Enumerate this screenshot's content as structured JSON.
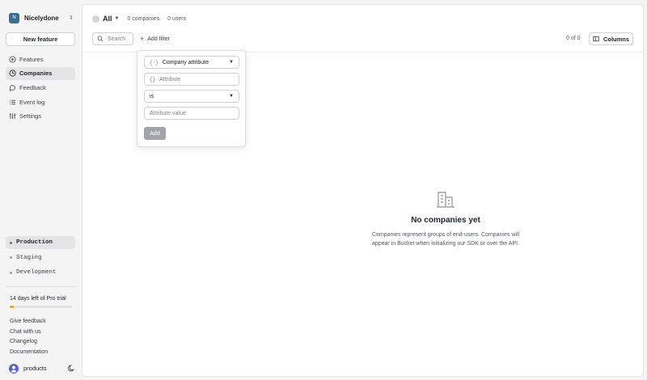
{
  "org": {
    "initial": "N",
    "name": "Nicelydone"
  },
  "sidebar": {
    "new_feature_label": "New feature",
    "nav": [
      {
        "label": "Features",
        "icon": "toggle-icon"
      },
      {
        "label": "Companies",
        "icon": "building-icon"
      },
      {
        "label": "Feedback",
        "icon": "chat-icon"
      },
      {
        "label": "Event log",
        "icon": "list-icon"
      },
      {
        "label": "Settings",
        "icon": "sliders-icon"
      }
    ],
    "environments": [
      "Production",
      "Staging",
      "Development"
    ],
    "trial_text": "14 days left of Pro trial",
    "trial_progress": 0.07,
    "links": [
      "Give feedback",
      "Chat with us",
      "Changelog",
      "Documentation"
    ],
    "user_name": "products"
  },
  "header": {
    "segment_label": "All",
    "companies_count": "0 companies",
    "users_count": "0 users"
  },
  "filterbar": {
    "search_placeholder": "Search",
    "add_filter_label": "Add filter",
    "pager": "0 of 0",
    "columns_label": "Columns"
  },
  "filter_popover": {
    "type_select": "Company attribute",
    "type_prefix": "{⋅}",
    "attribute_placeholder": "Attribute",
    "attribute_prefix": "{}",
    "operator_select": "is",
    "value_placeholder": "Attribute value",
    "add_label": "Add"
  },
  "empty_state": {
    "title": "No companies yet",
    "description": "Companies represent groups of end-users. Companies will appear in Bucket when initializing our SDK or over the API."
  },
  "colors": {
    "trial_accent": "#f5a623",
    "active_bg": "#e4e4e7",
    "avatar": "#5b5fc7"
  }
}
